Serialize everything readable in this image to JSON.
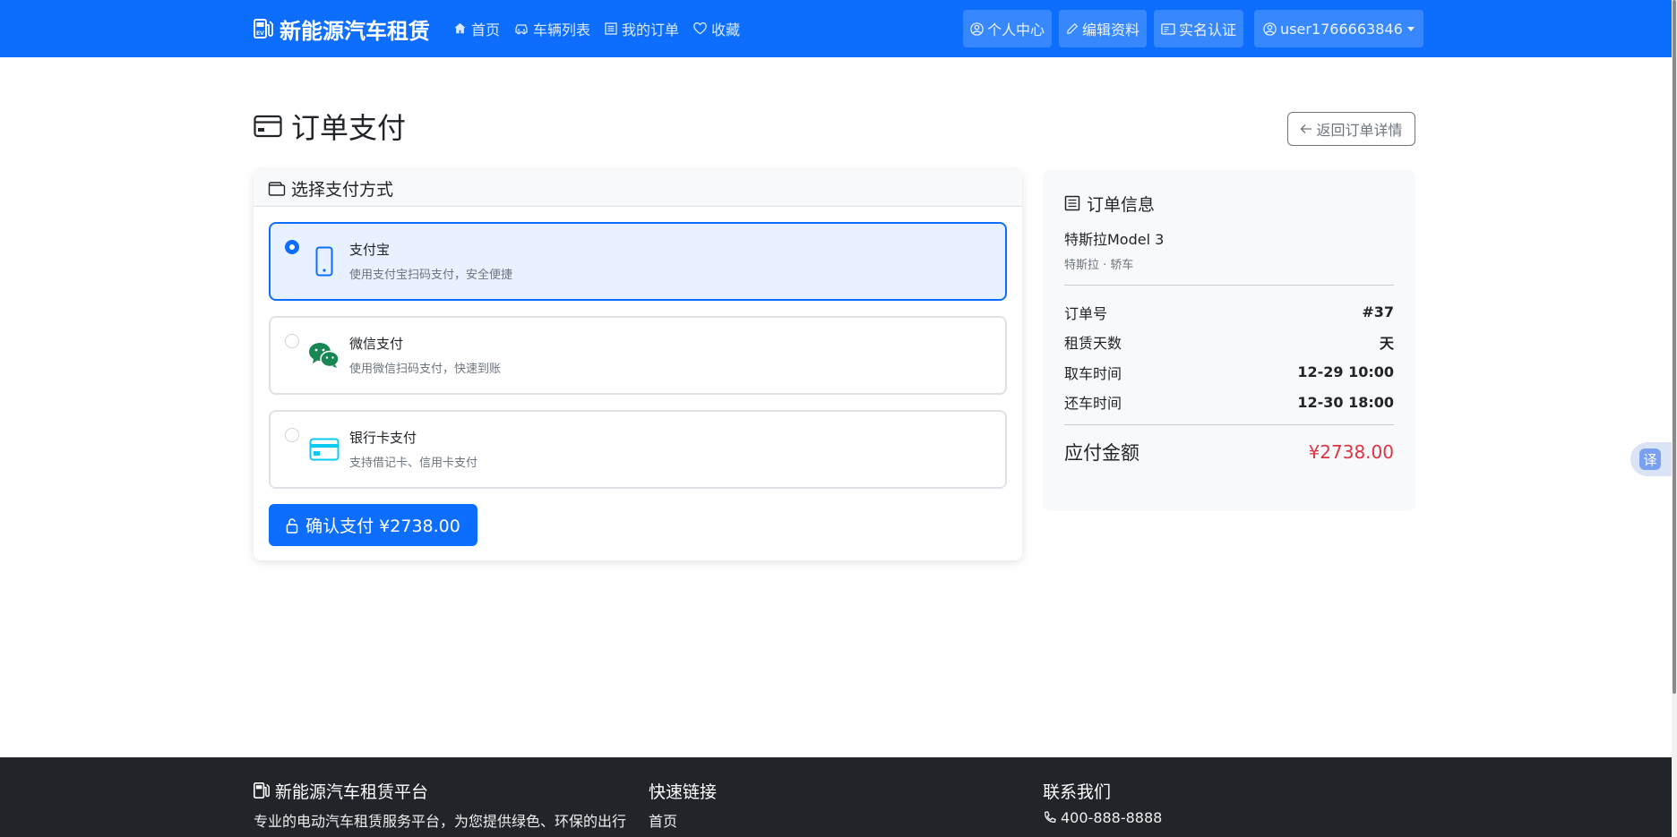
{
  "navbar": {
    "brand": "新能源汽车租赁",
    "links": [
      {
        "label": "首页",
        "icon": "house-icon"
      },
      {
        "label": "车辆列表",
        "icon": "car-icon"
      },
      {
        "label": "我的订单",
        "icon": "list-icon"
      },
      {
        "label": "收藏",
        "icon": "heart-icon"
      }
    ],
    "right": [
      {
        "label": "个人中心",
        "icon": "person-circle-icon"
      },
      {
        "label": "编辑资料",
        "icon": "pencil-icon"
      },
      {
        "label": "实名认证",
        "icon": "id-card-icon"
      }
    ],
    "user": "user1766663846"
  },
  "page": {
    "title": "订单支付",
    "back_label": "返回订单详情"
  },
  "payment": {
    "header": "选择支付方式",
    "options": [
      {
        "title": "支付宝",
        "desc": "使用支付宝扫码支付，安全便捷",
        "selected": true,
        "icon": "phone-icon"
      },
      {
        "title": "微信支付",
        "desc": "使用微信扫码支付，快速到账",
        "selected": false,
        "icon": "wechat-icon"
      },
      {
        "title": "银行卡支付",
        "desc": "支持借记卡、信用卡支付",
        "selected": false,
        "icon": "credit-card-icon"
      }
    ],
    "confirm_label": "确认支付 ¥2738.00"
  },
  "order": {
    "title": "订单信息",
    "car_name": "特斯拉Model 3",
    "car_meta": "特斯拉 · 轿车",
    "rows": [
      {
        "label": "订单号",
        "value": "#37"
      },
      {
        "label": "租赁天数",
        "value": "天"
      },
      {
        "label": "取车时间",
        "value": "12-29 10:00"
      },
      {
        "label": "还车时间",
        "value": "12-30 18:00"
      }
    ],
    "total_label": "应付金额",
    "total_value": "¥2738.00"
  },
  "translate": {
    "label": "译"
  },
  "footer": {
    "col1_title": "新能源汽车租赁平台",
    "col1_text": "专业的电动汽车租赁服务平台，为您提供绿色、环保的出行",
    "col2_title": "快速链接",
    "col2_text": "首页",
    "col3_title": "联系我们",
    "col3_text": "400-888-8888"
  },
  "colors": {
    "primary": "#0d6efd",
    "danger": "#dc3545",
    "footer_bg": "#212529",
    "wechat": "#198754",
    "card": "#0dcaf0"
  }
}
